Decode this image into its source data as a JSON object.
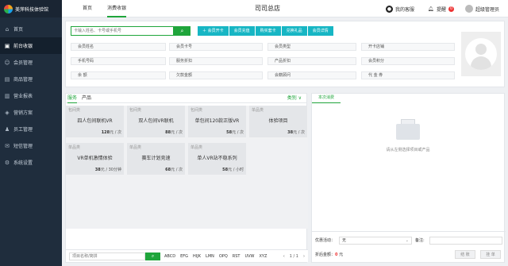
{
  "app": {
    "brand_name": "美萍科技体验馆"
  },
  "sidebar": {
    "items": [
      {
        "label": "首页",
        "icon": "home-icon",
        "active": false
      },
      {
        "label": "前台收银",
        "icon": "cashier-icon",
        "active": true
      },
      {
        "label": "会员管理",
        "icon": "member-icon",
        "active": false
      },
      {
        "label": "商品管理",
        "icon": "goods-icon",
        "active": false
      },
      {
        "label": "营业报表",
        "icon": "report-icon",
        "active": false
      },
      {
        "label": "营销方案",
        "icon": "marketing-icon",
        "active": false
      },
      {
        "label": "员工管理",
        "icon": "staff-icon",
        "active": false
      },
      {
        "label": "短信管理",
        "icon": "sms-icon",
        "active": false
      },
      {
        "label": "系统设置",
        "icon": "settings-icon",
        "active": false
      }
    ]
  },
  "header": {
    "tabs": [
      {
        "label": "首页"
      },
      {
        "label": "消费收银"
      }
    ],
    "store_name": "司司总店",
    "service_label": "我的客服",
    "reminder_label": "提醒",
    "reminder_count": "0",
    "user_label": "超级管理员"
  },
  "member": {
    "search_placeholder": "卡输入姓名、卡号或手机号",
    "actions": [
      "＋ 会员开卡",
      "会员充值",
      "购买套卡",
      "兑换礼品",
      "会员详情"
    ],
    "fields": [
      "会员姓名",
      "会员卡号",
      "会员类型",
      "开卡店铺",
      "手机号码",
      "服务折扣",
      "产品折扣",
      "会员积分",
      "余 额",
      "欠款金额",
      "会籍顾问",
      "代 金 券"
    ]
  },
  "services": {
    "tabs": [
      "服务",
      "产品"
    ],
    "type_filter": "类别 ∨",
    "cards": [
      {
        "category": "包间类",
        "name": "四人包间联机VR",
        "price": "128",
        "unit": "元 / 次"
      },
      {
        "category": "包间类",
        "name": "双人包间VR联机",
        "price": "88",
        "unit": "元 / 次"
      },
      {
        "category": "包间类",
        "name": "单包间120款正版VR",
        "price": "58",
        "unit": "元 / 次"
      },
      {
        "category": "单品类",
        "name": "体验项目",
        "price": "38",
        "unit": "元 / 次"
      },
      {
        "category": "单品类",
        "name": "VR单机激情体验",
        "price": "38",
        "unit": "元 / 30分钟"
      },
      {
        "category": "单品类",
        "name": "赛车计划竞速",
        "price": "68",
        "unit": "元 / 次"
      },
      {
        "category": "单品类",
        "name": "单人VR站不稳系列",
        "price": "58",
        "unit": "元 / 小时"
      }
    ],
    "search_placeholder": "项目名称/简拼",
    "letters": [
      "ABCD",
      "EFG",
      "HIJK",
      "LMN",
      "OPQ",
      "RST",
      "UVW",
      "XYZ"
    ],
    "pager": {
      "prev": "‹",
      "page": "1 / 1",
      "next": "›"
    }
  },
  "cart": {
    "tab_label": "本次消费",
    "empty_text": "请从左侧选择项目或产品",
    "promo_label": "优惠活动：",
    "promo_value": "无",
    "remark_label": "备注:",
    "total_label": "折后金额：",
    "total_value": "0",
    "total_unit": "元",
    "checkout_label": "结 账",
    "hold_label": "挂 单"
  },
  "colors": {
    "accent": "#1fa53b",
    "sidebar": "#1f2d3d",
    "action": "#17b6c4",
    "alert": "#e33333"
  }
}
